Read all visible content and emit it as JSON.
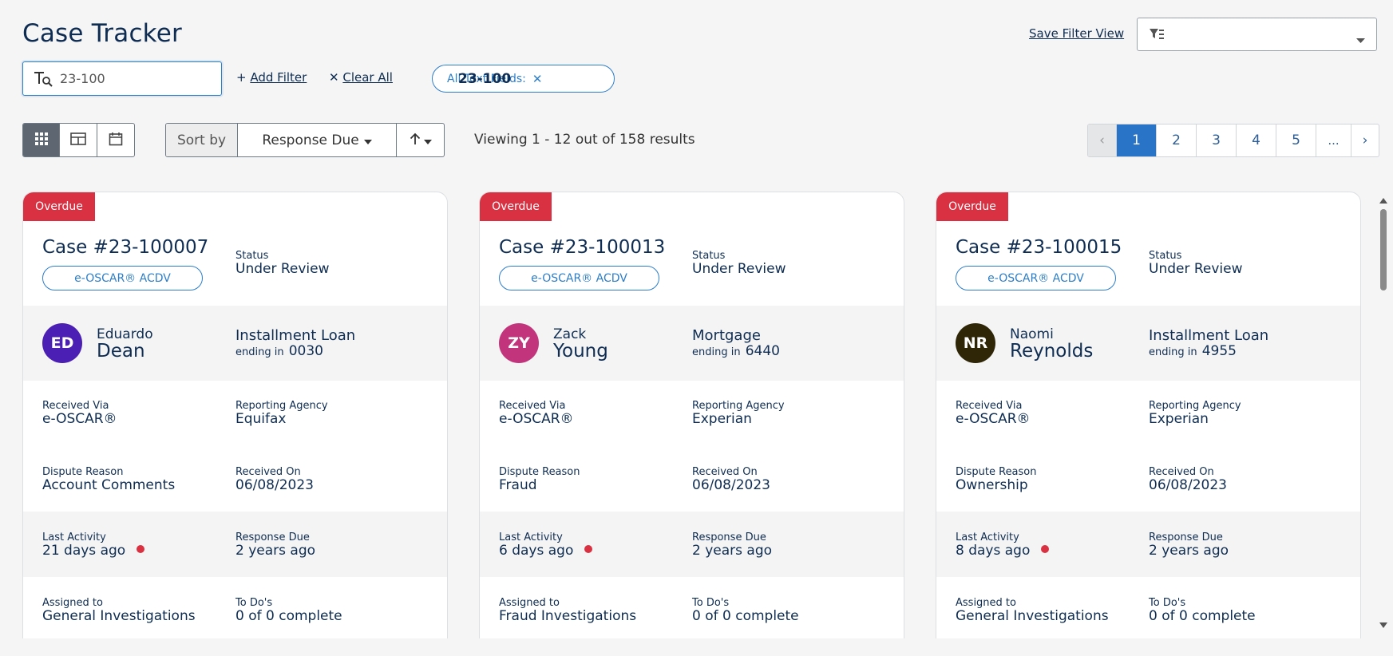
{
  "header": {
    "title": "Case Tracker",
    "save_filter_view": "Save Filter View"
  },
  "search": {
    "value": "23-100"
  },
  "filters": {
    "add_filter": "Add Filter",
    "clear_all": "Clear All",
    "chip_label": "All Text Fields:",
    "chip_value": "23-100"
  },
  "toolbar": {
    "sort_label": "Sort by",
    "sort_field": "Response Due",
    "viewing": "Viewing 1 - 12 out of 158 results"
  },
  "pagination": {
    "prev": "‹",
    "pages": [
      "1",
      "2",
      "3",
      "4",
      "5"
    ],
    "active_page": "1",
    "ellipsis": "...",
    "next": "›"
  },
  "labels": {
    "status": "Status",
    "ending_in": "ending in",
    "received_via": "Received Via",
    "reporting_agency": "Reporting Agency",
    "dispute_reason": "Dispute Reason",
    "received_on": "Received On",
    "last_activity": "Last Activity",
    "response_due": "Response Due",
    "assigned_to": "Assigned to",
    "todos": "To Do's"
  },
  "cards": [
    {
      "badge": "Overdue",
      "case_number": "Case #23-100007",
      "type": "e-OSCAR® ACDV",
      "status": "Under Review",
      "initials": "ED",
      "avatar_color": "#4b1fb3",
      "first_name": "Eduardo",
      "last_name": "Dean",
      "account_type": "Installment Loan",
      "account_ending": "0030",
      "received_via": "e-OSCAR®",
      "reporting_agency": "Equifax",
      "dispute_reason": "Account Comments",
      "received_on": "06/08/2023",
      "last_activity": "21 days ago",
      "response_due": "2 years ago",
      "assigned_to": "General Investigations",
      "todos": "0 of 0 complete"
    },
    {
      "badge": "Overdue",
      "case_number": "Case #23-100013",
      "type": "e-OSCAR® ACDV",
      "status": "Under Review",
      "initials": "ZY",
      "avatar_color": "#c2357c",
      "first_name": "Zack",
      "last_name": "Young",
      "account_type": "Mortgage",
      "account_ending": "6440",
      "received_via": "e-OSCAR®",
      "reporting_agency": "Experian",
      "dispute_reason": "Fraud",
      "received_on": "06/08/2023",
      "last_activity": "6 days ago",
      "response_due": "2 years ago",
      "assigned_to": "Fraud Investigations",
      "todos": "0 of 0 complete"
    },
    {
      "badge": "Overdue",
      "case_number": "Case #23-100015",
      "type": "e-OSCAR® ACDV",
      "status": "Under Review",
      "initials": "NR",
      "avatar_color": "#2f2608",
      "first_name": "Naomi",
      "last_name": "Reynolds",
      "account_type": "Installment Loan",
      "account_ending": "4955",
      "received_via": "e-OSCAR®",
      "reporting_agency": "Experian",
      "dispute_reason": "Ownership",
      "received_on": "06/08/2023",
      "last_activity": "8 days ago",
      "response_due": "2 years ago",
      "assigned_to": "General Investigations",
      "todos": "0 of 0 complete"
    }
  ]
}
